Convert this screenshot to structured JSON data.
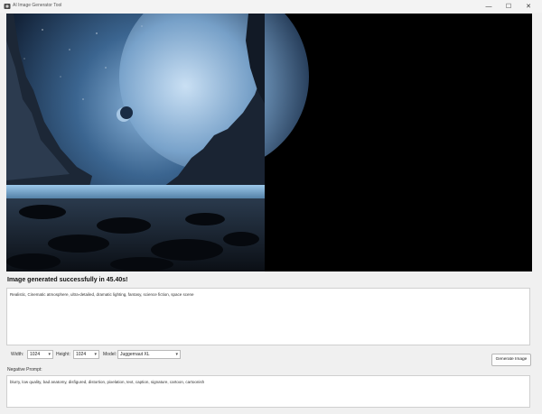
{
  "window": {
    "title": "AI Image Generator Tool",
    "icon": "app-icon",
    "controls": {
      "minimize": "—",
      "maximize": "☐",
      "close": "✕"
    }
  },
  "image": {
    "description_icon": "generated-image"
  },
  "status": {
    "message": "Image generated successfully in 45.40s!"
  },
  "prompt": {
    "value": "Realistic, Cinematic atmosphere, ultra-detailed, dramatic lighting, fantasy, science fiction, space scene"
  },
  "settings": {
    "width_label": "Width:",
    "width_value": "1024",
    "height_label": "Height:",
    "height_value": "1024",
    "model_label": "Model:",
    "model_value": "Juggernaut XL"
  },
  "actions": {
    "generate_label": "Generate Image"
  },
  "negative_prompt": {
    "label": "Negative Prompt:",
    "value": "blurry, low quality, bad anatomy, disfigured, distortion, pixelation, text, caption, signature, cartoon, cartoonish"
  },
  "colors": {
    "window_bg": "#f0f0f0",
    "panel_bg": "#000000",
    "text": "#111111"
  }
}
